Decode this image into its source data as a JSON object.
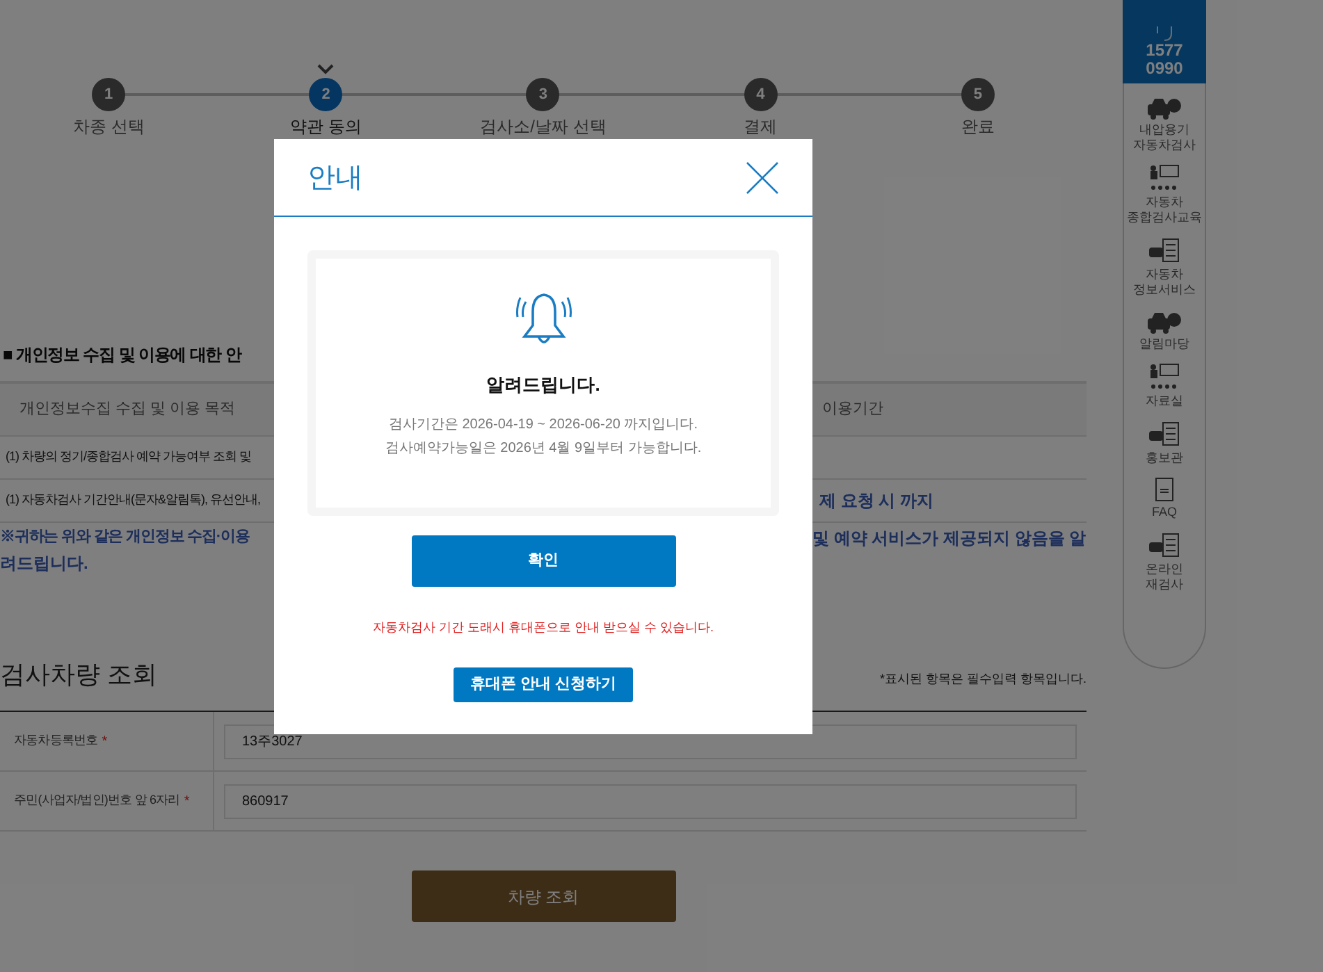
{
  "steps": [
    {
      "number": "1",
      "label": "차종 선택",
      "selected": false
    },
    {
      "number": "2",
      "label": "약관 동의",
      "selected": true
    },
    {
      "number": "3",
      "label": "검사소/날짜 선택",
      "selected": false
    },
    {
      "number": "4",
      "label": "결제",
      "selected": false
    },
    {
      "number": "5",
      "label": "완료",
      "selected": false
    }
  ],
  "privacy_section": {
    "title": "■ 개인정보 수집 및 이용에 대한 안",
    "header": {
      "column_1": "개인정보수집 수집 및 이용 목적",
      "column_2": "이용기간"
    },
    "rows": [
      {
        "column_1": "(1) 차량의 정기/종합검사 예약 가능여부 조회 및"
      },
      {
        "column_1": "(1) 자동차검사 기간안내(문자&알림톡), 유선안내,",
        "column_2": "제 요청 시 까지"
      }
    ],
    "notice": {
      "left": "※귀하는 위와 같은 개인정보 수집·이용",
      "right": "및 예약 서비스가 제공되지 않음을 알",
      "second_line": "려드립니다."
    }
  },
  "vehicle_search": {
    "title": "검사차량 조회",
    "required_note": "*표시된 항목은 필수입력 항목입니다.",
    "fields": [
      {
        "label": "자동차등록번호",
        "required_mark": "*",
        "value": "13주3027"
      },
      {
        "label": "주민(사업자/법인)번호 앞 6자리",
        "required_mark": "*",
        "value": "860917"
      }
    ],
    "button": "차량 조회"
  },
  "sidebar": {
    "phone": [
      "1577",
      "0990"
    ],
    "items": [
      {
        "kind": "car",
        "lines": [
          "내압용기",
          "자동차검사"
        ]
      },
      {
        "kind": "teacher",
        "lines": [
          "자동차",
          "종합검사교육"
        ]
      },
      {
        "kind": "checklist",
        "lines": [
          "자동차",
          "정보서비스"
        ]
      },
      {
        "kind": "car",
        "lines": [
          "알림마당"
        ]
      },
      {
        "kind": "teacher",
        "lines": [
          "자료실"
        ]
      },
      {
        "kind": "checklist",
        "lines": [
          "홍보관"
        ]
      },
      {
        "kind": "notebook",
        "lines": [
          "FAQ"
        ]
      },
      {
        "kind": "checklist",
        "lines": [
          "온라인",
          "재검사"
        ]
      }
    ]
  },
  "modal": {
    "title": "안내",
    "heading": "알려드립니다.",
    "message": [
      "검사기간은 2026-04-19 ~ 2026-06-20 까지입니다.",
      "검사예약가능일은 2026년 4월 9일부터 가능합니다."
    ],
    "confirm": "확인",
    "sms_notice": "자동차검사 기간 도래시 휴대폰으로 안내 받으실 수 있습니다.",
    "sms_button": "휴대폰 안내 신청하기"
  }
}
